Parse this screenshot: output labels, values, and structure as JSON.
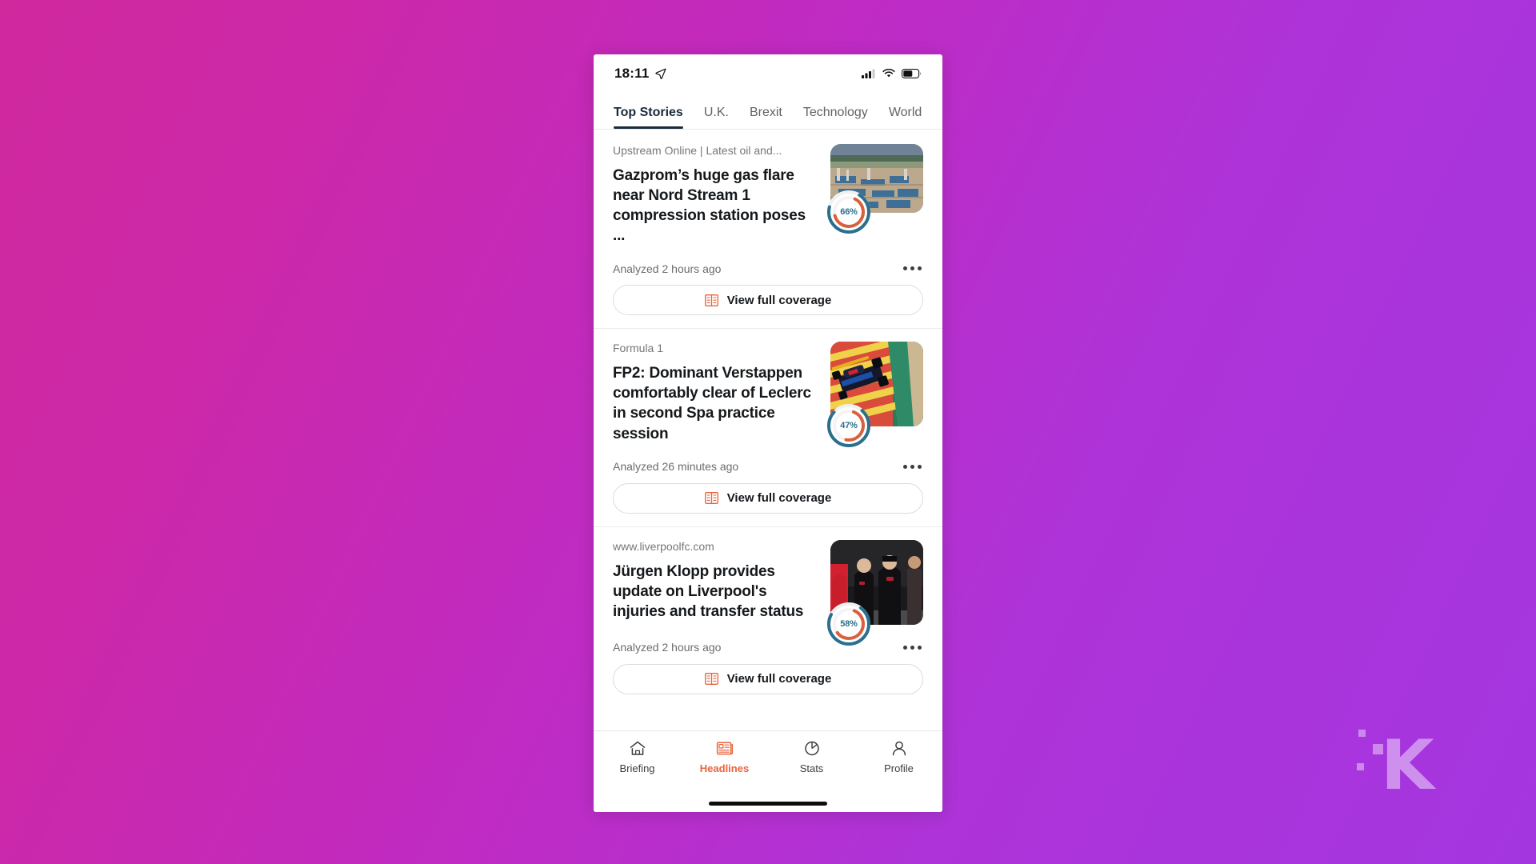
{
  "background": {
    "gradient_from": "#d0299e",
    "gradient_to": "#a436e0"
  },
  "watermark": {
    "letter": "K",
    "name": "knowtechie-logo"
  },
  "status_bar": {
    "time": "18:11",
    "location_icon": "location-arrow-icon",
    "signal_icon": "cellular-signal-icon",
    "wifi_icon": "wifi-icon",
    "battery_icon": "battery-icon"
  },
  "tabs": [
    {
      "label": "Top Stories",
      "active": true
    },
    {
      "label": "U.K.",
      "active": false
    },
    {
      "label": "Brexit",
      "active": false
    },
    {
      "label": "Technology",
      "active": false
    },
    {
      "label": "World",
      "active": false
    }
  ],
  "coverage_button_label": "View full coverage",
  "articles": [
    {
      "source": "Upstream Online | Latest oil and...",
      "title": "Gazprom’s huge gas flare near Nord Stream 1 compression station poses ...",
      "score": "66%",
      "score_value": 66,
      "analyzed": "Analyzed 2 hours ago",
      "thumb": "gas-plant-photo"
    },
    {
      "source": "Formula 1",
      "title": "FP2: Dominant Verstappen comfortably clear of Leclerc in second Spa practice session",
      "score": "47%",
      "score_value": 47,
      "analyzed": "Analyzed 26 minutes ago",
      "thumb": "formula1-car-photo"
    },
    {
      "source": "www.liverpoolfc.com",
      "title": "Jürgen Klopp provides update on Liverpool's injuries and transfer status",
      "score": "58%",
      "score_value": 58,
      "analyzed": "Analyzed 2 hours ago",
      "thumb": "liverpool-training-photo"
    }
  ],
  "bottom_nav": [
    {
      "label": "Briefing",
      "icon": "home-icon",
      "active": false
    },
    {
      "label": "Headlines",
      "icon": "newspaper-icon",
      "active": true
    },
    {
      "label": "Stats",
      "icon": "pie-chart-icon",
      "active": false
    },
    {
      "label": "Profile",
      "icon": "person-icon",
      "active": false
    }
  ],
  "colors": {
    "accent_orange": "#e8643c",
    "gauge_teal": "#2a6f8e",
    "gauge_orange": "#d9603c",
    "tab_active": "#1a2b3c"
  }
}
